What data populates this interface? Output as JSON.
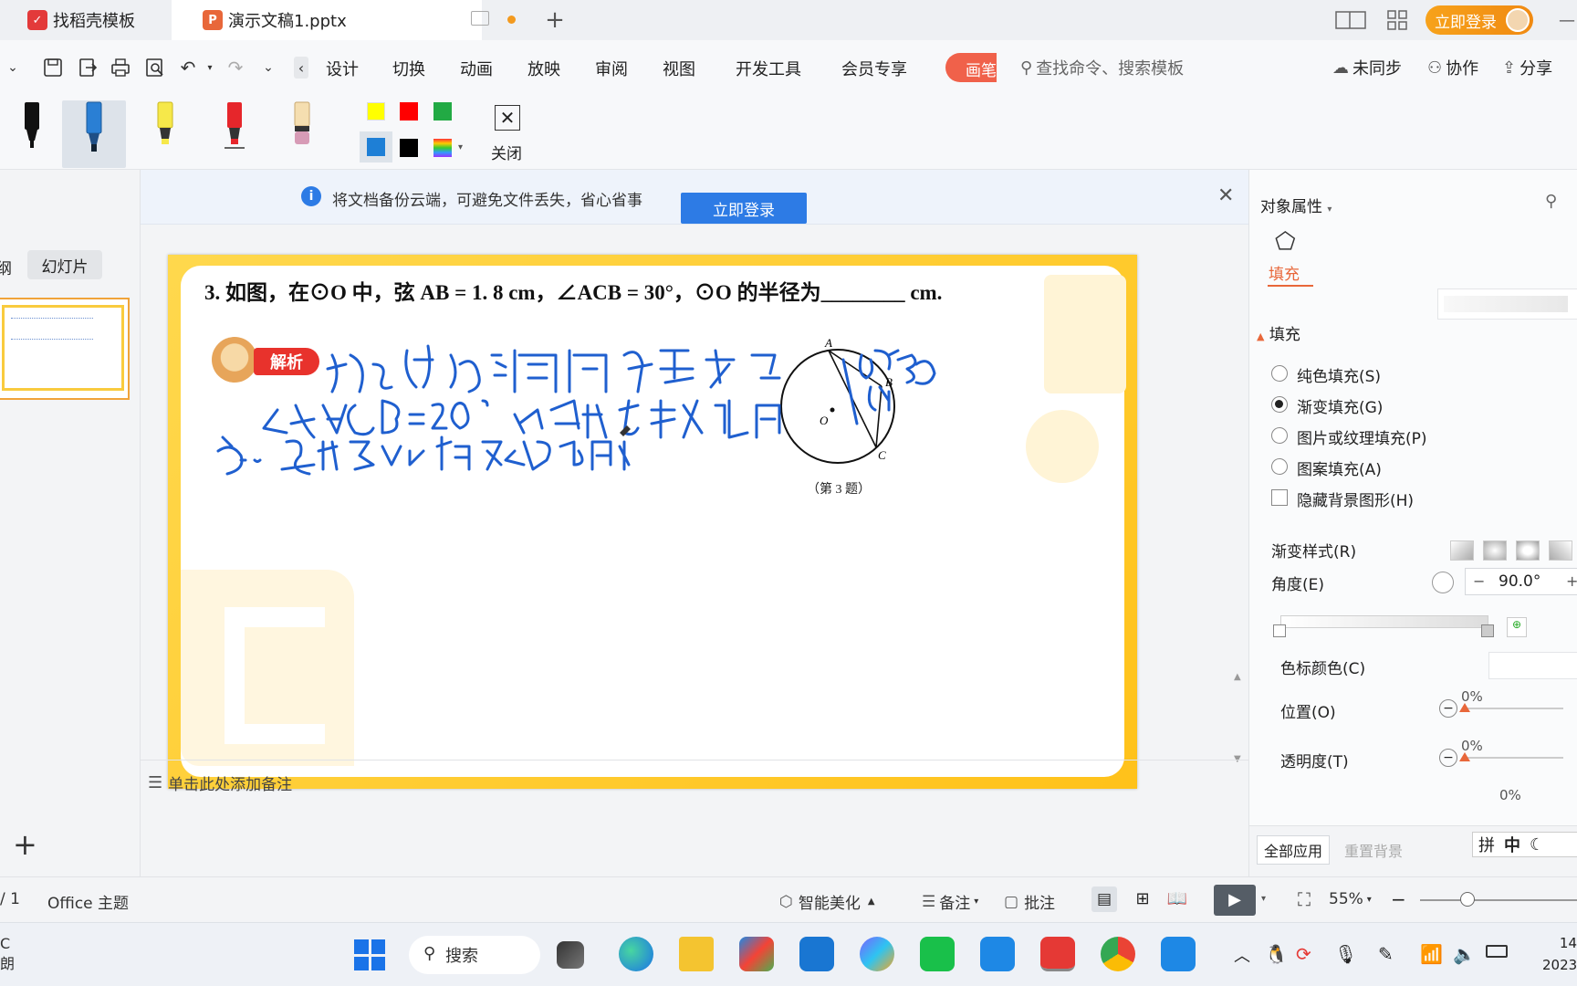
{
  "titlebar": {
    "tabs": [
      {
        "label": "找稻壳模板",
        "icon": "docer-icon"
      },
      {
        "label": "演示文稿1.pptx",
        "icon": "presentation-icon"
      }
    ],
    "new_tab": "+",
    "login_label": "立即登录"
  },
  "menubar": {
    "items": [
      "设计",
      "切换",
      "动画",
      "放映",
      "审阅",
      "视图",
      "开发工具",
      "会员专享"
    ],
    "pen_tab": "画笔",
    "search_placeholder": "查找命令、搜索模板",
    "right": {
      "sync": "未同步",
      "collab": "协作",
      "share": "分享"
    }
  },
  "pentools": {
    "colors": [
      "#ffff00",
      "#ff0000",
      "#22aa44",
      "#1e7fd6",
      "#000000"
    ],
    "close_label": "关闭"
  },
  "leftpanel": {
    "tab_outline": "纲",
    "tab_slides": "幻灯片",
    "add": "+"
  },
  "notice": {
    "text": "将文档备份云端，可避免文件丢失，省心省事",
    "button": "立即登录"
  },
  "slide": {
    "question": "3. 如图，在⊙O 中，弦 AB = 1. 8 cm，∠ACB = 30°，⊙O 的半径为________ cm.",
    "badge": "解析",
    "figure_caption": "（第 3 题）",
    "figure_labels": {
      "A": "A",
      "B": "B",
      "C": "C",
      "O": "O"
    }
  },
  "notes": {
    "placeholder": "单击此处添加备注"
  },
  "rightpanel": {
    "header": "对象属性",
    "tab": "填充",
    "section": "填充",
    "options": [
      {
        "label": "纯色填充(S)",
        "selected": false
      },
      {
        "label": "渐变填充(G)",
        "selected": true
      },
      {
        "label": "图片或纹理填充(P)",
        "selected": false
      },
      {
        "label": "图案填充(A)",
        "selected": false
      }
    ],
    "hide_bg": "隐藏背景图形(H)",
    "gradient_style": "渐变样式(R)",
    "angle_label": "角度(E)",
    "angle_value": "90.0°",
    "stop_color": "色标颜色(C)",
    "position_label": "位置(O)",
    "position_value": "0%",
    "transparency_label": "透明度(T)",
    "transparency_value": "0%",
    "brightness_value": "0%",
    "apply_all": "全部应用",
    "reset_bg": "重置背景"
  },
  "statusbar": {
    "page": "/ 1",
    "theme": "Office 主题",
    "beautify": "智能美化",
    "notes": "备注",
    "comments": "批注",
    "zoom": "55%",
    "ime": [
      "拼",
      "中"
    ]
  },
  "taskbar": {
    "search": "搜索",
    "weather_top": "C",
    "weather_bottom": "朗",
    "time": "14",
    "date": "2023/"
  }
}
